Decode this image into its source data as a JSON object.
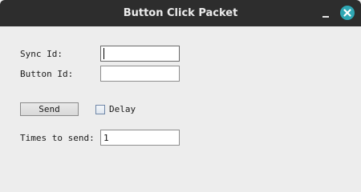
{
  "window": {
    "title": "Button Click Packet"
  },
  "form": {
    "sync_id": {
      "label": "Sync Id:",
      "value": ""
    },
    "button_id": {
      "label": "Button Id:",
      "value": ""
    },
    "send_label": "Send",
    "delay": {
      "label": "Delay",
      "checked": false
    },
    "times_to_send": {
      "label": "Times to send:",
      "value": "1"
    }
  },
  "colors": {
    "titlebar": "#2d2d2d",
    "close_button": "#2fa7b4",
    "background": "#ededed"
  },
  "icons": {
    "minimize": "minimize-icon",
    "close": "close-icon"
  }
}
